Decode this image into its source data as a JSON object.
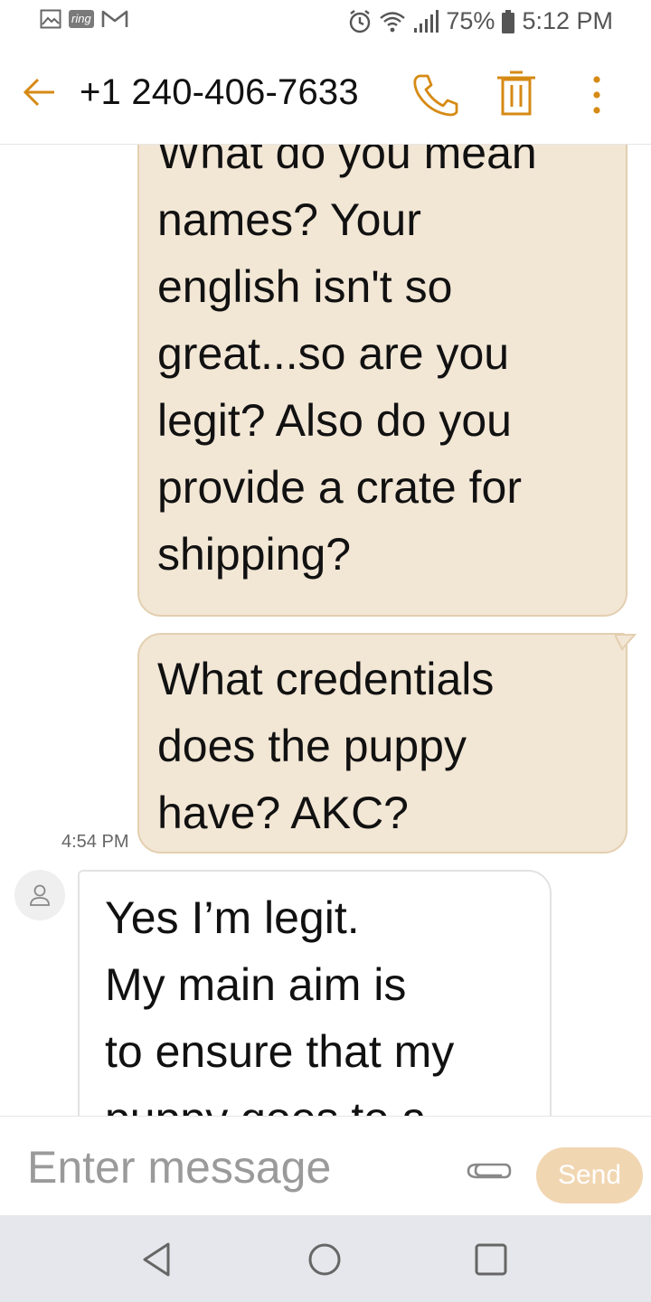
{
  "status_bar": {
    "left_icons": [
      "gallery-icon",
      "ring-icon",
      "gmail-icon"
    ],
    "ring_label": "ring",
    "right_icons": [
      "alarm-icon",
      "wifi-icon",
      "signal-icon",
      "battery-icon"
    ],
    "battery": "75%",
    "time": "5:12 PM"
  },
  "header": {
    "contact": "+1 240-406-7633",
    "accent_color": "#d68a14",
    "actions": [
      "call-icon",
      "delete-icon",
      "more-vert-icon"
    ]
  },
  "messages": {
    "sent_1": {
      "lines": [
        "What do you mean",
        "names? Your",
        "english isn't so",
        "great...so are you",
        "legit? Also do you",
        "provide a crate for",
        "shipping?"
      ]
    },
    "sent_2": {
      "lines": [
        "What credentials",
        "does the puppy",
        "have? AKC?"
      ],
      "time": "4:54 PM"
    },
    "received_1": {
      "lines": [
        "Yes I’m legit.",
        "My main aim is",
        "to ensure that my",
        "puppy goes to a"
      ]
    }
  },
  "composer": {
    "placeholder": "Enter message",
    "send_label": "Send"
  },
  "colors": {
    "sent_bubble": "#f2e6d5",
    "received_bubble": "#ffffff",
    "send_button": "#f1d6b2",
    "nav_bar": "#e6e7ec"
  }
}
